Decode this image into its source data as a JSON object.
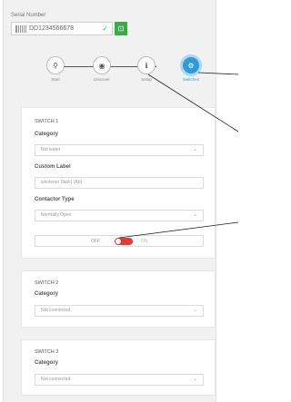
{
  "serial": {
    "label": "Serial Number",
    "value": "DD1234566678",
    "check_icon": "check-icon",
    "scan_icon": "scan-icon"
  },
  "stepper": {
    "steps": [
      {
        "label": "Start",
        "icon": "person-icon"
      },
      {
        "label": "Discover",
        "icon": "eye-icon"
      },
      {
        "label": "Setup",
        "icon": "info-icon"
      },
      {
        "label": "Switches",
        "icon": "switches-icon",
        "active": true
      }
    ]
  },
  "switches": [
    {
      "title": "SWITCH 1",
      "category_label": "Category",
      "category_value": "Not water",
      "custom_label_label": "Custom Label",
      "custom_label_value": "wholener (tank) (Ab)",
      "contactor_label": "Contactor Type",
      "contactor_value": "Normally Open",
      "toggle_off": "OFF",
      "toggle_on": "ON",
      "toggle_state": "off"
    },
    {
      "title": "SWITCH 2",
      "category_label": "Category",
      "category_value": "Not connected"
    },
    {
      "title": "SWITCH 3",
      "category_label": "Category",
      "category_value": "Not connected"
    }
  ],
  "colors": {
    "accent": "#2e9bd6",
    "success": "#3aaa47",
    "toggle": "#e53935"
  }
}
